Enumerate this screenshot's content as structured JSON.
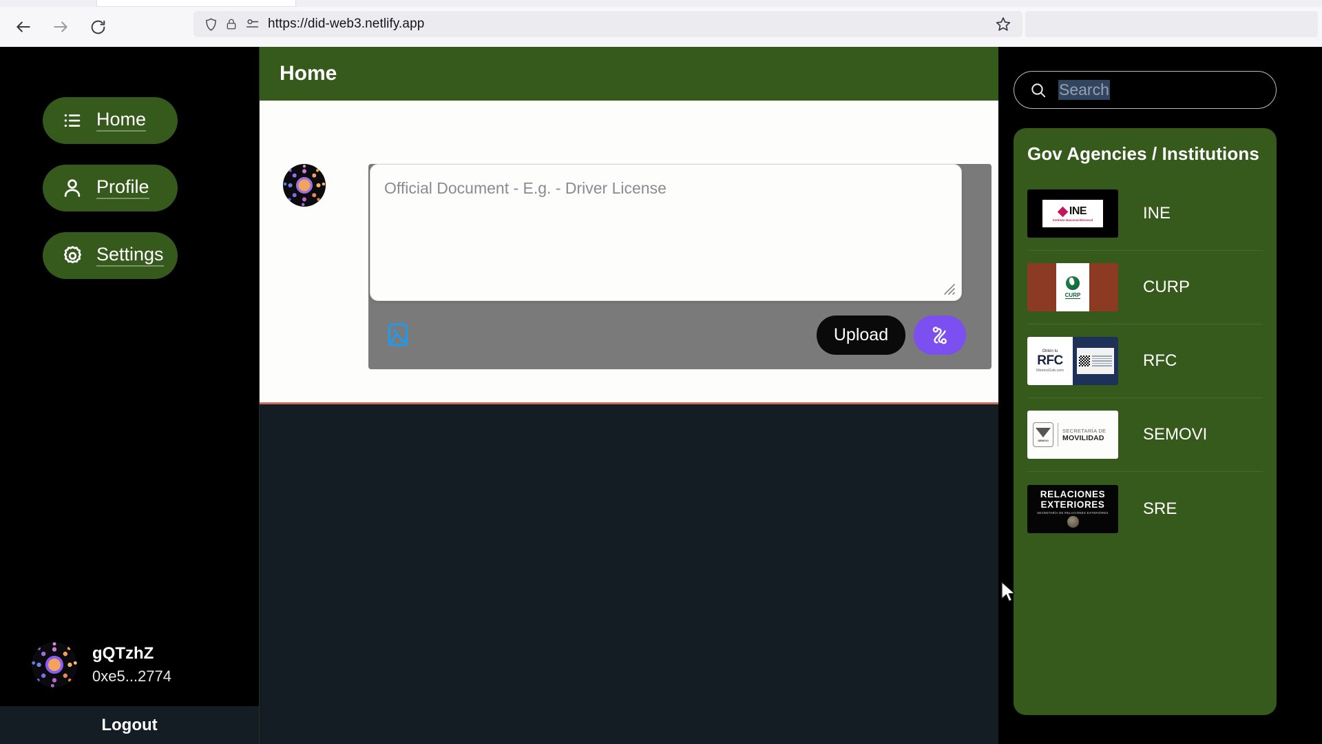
{
  "browser": {
    "url": "https://did-web3.netlify.app",
    "back_icon": "back-arrow-icon",
    "forward_icon": "forward-arrow-icon",
    "reload_icon": "reload-icon",
    "shield_icon": "shield-icon",
    "lock_icon": "lock-icon",
    "permissions_icon": "permissions-icon",
    "bookmark_icon": "star-icon"
  },
  "sidebar": {
    "items": [
      {
        "label": "Home",
        "icon": "list-icon"
      },
      {
        "label": "Profile",
        "icon": "user-icon"
      },
      {
        "label": "Settings",
        "icon": "gear-icon"
      }
    ],
    "user": {
      "name": "gQTzhZ",
      "address": "0xe5...2774"
    },
    "logout_label": "Logout"
  },
  "main": {
    "header_title": "Home",
    "composer": {
      "placeholder": "Official Document - E.g. - Driver License",
      "value": "",
      "image_icon": "image-icon",
      "upload_label": "Upload",
      "chain_icon": "polygon-chain-icon"
    }
  },
  "right": {
    "search": {
      "placeholder": "Search",
      "value": "",
      "icon": "search-icon"
    },
    "panel_title": "Gov Agencies / Institutions",
    "agencies": [
      {
        "name": "INE",
        "logo": "ine-logo",
        "logo_text": "INE",
        "logo_subtext": "Instituto Nacional Electoral"
      },
      {
        "name": "CURP",
        "logo": "curp-logo",
        "logo_text": "CURP"
      },
      {
        "name": "RFC",
        "logo": "rfc-logo",
        "logo_text": "RFC",
        "logo_subtext": "Obtén tu",
        "logo_footer": "MexicoGob.com"
      },
      {
        "name": "SEMOVI",
        "logo": "semovi-logo",
        "logo_text": "SECRETARÍA DE",
        "logo_subtext": "MOVILIDAD",
        "logo_footer": "SEMOVI"
      },
      {
        "name": "SRE",
        "logo": "sre-logo",
        "logo_text": "RELACIONES",
        "logo_subtext": "EXTERIORES",
        "logo_footer": "SECRETARÍA DE RELACIONES EXTERIORES"
      }
    ]
  },
  "colors": {
    "green": "#355A1B",
    "dark_navy": "#141C24",
    "purple": "#7C4FF0",
    "accent_red": "#C96A5E",
    "image_icon_blue": "#1E9BF0"
  }
}
